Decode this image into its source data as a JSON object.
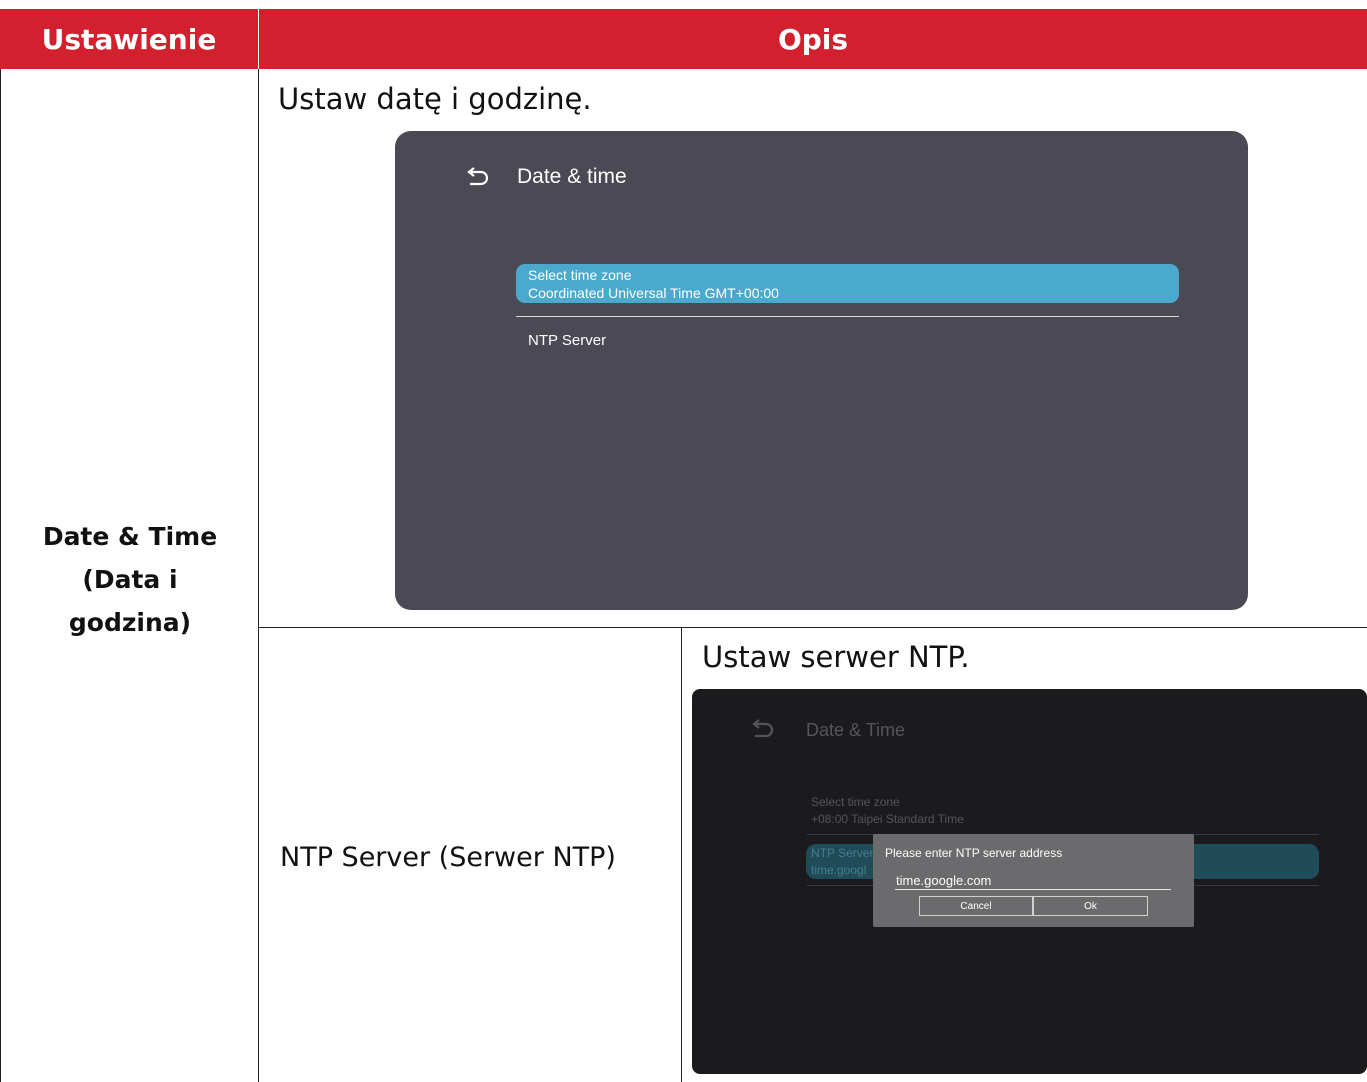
{
  "table": {
    "header_setting": "Ustawienie",
    "header_description": "Opis"
  },
  "row": {
    "setting_label": "Date & Time (Data i godzina)",
    "intro": "Ustaw datę i godzinę.",
    "sub_setting_label": "NTP Server (Serwer NTP)",
    "sub_intro": "Ustaw serwer NTP."
  },
  "screen1": {
    "title": "Date & time",
    "select_time_zone": "Select time zone",
    "time_zone_value": "Coordinated Universal Time GMT+00:00",
    "ntp_server": "NTP Server"
  },
  "screen2": {
    "title": "Date & Time",
    "select_time_zone": "Select time zone",
    "time_zone_value": "+08:00 Taipei Standard Time",
    "ntp_server_partial": "NTP Server",
    "ntp_value_partial": "time.googl",
    "dialog_title": "Please enter NTP server address",
    "dialog_input": "time.google.com",
    "cancel": "Cancel",
    "ok": "Ok"
  },
  "colors": {
    "header_red": "#d2202e",
    "selected_blue": "#4aa9cd",
    "dark_panel": "#4b4a54"
  }
}
